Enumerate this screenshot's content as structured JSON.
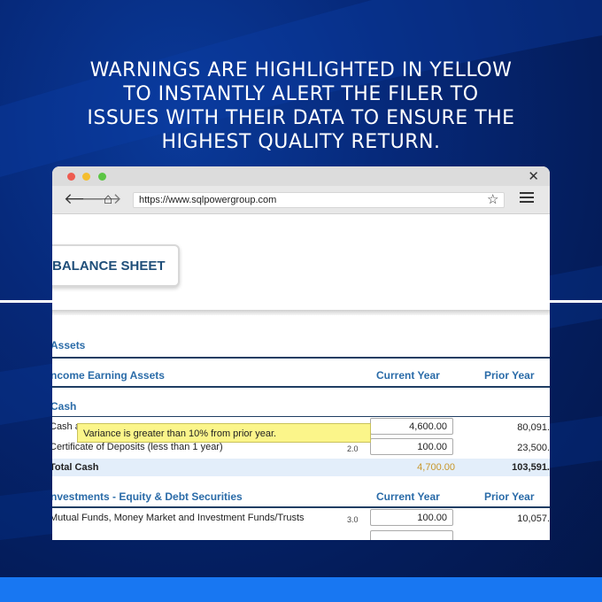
{
  "headline": {
    "line1": "WARNINGS ARE HIGHLIGHTED IN YELLOW",
    "line2": "TO INSTANTLY ALERT THE FILER TO",
    "line3": "ISSUES WITH THEIR DATA TO ENSURE THE",
    "line4": "HIGHEST QUALITY RETURN."
  },
  "browser": {
    "url": "https://www.sqlpowergroup.com"
  },
  "sheet": {
    "tab_title": "BALANCE SHEET",
    "assets": "Assets",
    "income_earning_assets": "ncome Earning Assets",
    "current_year": "Current Year",
    "prior_year": "Prior Year",
    "cash": "Cash",
    "cash_row": {
      "label": "Cash a",
      "current": "4,600.00",
      "prior": "80,091."
    },
    "cd_row": {
      "label": "Certificate of Deposits (less than 1 year)",
      "line": "2.0",
      "current": "100.00",
      "prior": "23,500."
    },
    "total_cash": {
      "label": "Total Cash",
      "current": "4,700.00",
      "prior": "103,591."
    },
    "investments": "nvestments - Equity & Debt Securities",
    "current_year_2": "Current Year",
    "prior_year_2": "Prior Year",
    "mutual_row": {
      "label": "Mutual Funds, Money Market and Investment Funds/Trusts",
      "line": "3.0",
      "current": "100.00",
      "prior": "10,057."
    },
    "warning": "Variance is greater than 10% from prior year."
  },
  "colors": {
    "background": "#06297a",
    "accent_bar": "#1877f2",
    "warning": "#fbf58a",
    "heading_blue": "#2a6ba8"
  }
}
